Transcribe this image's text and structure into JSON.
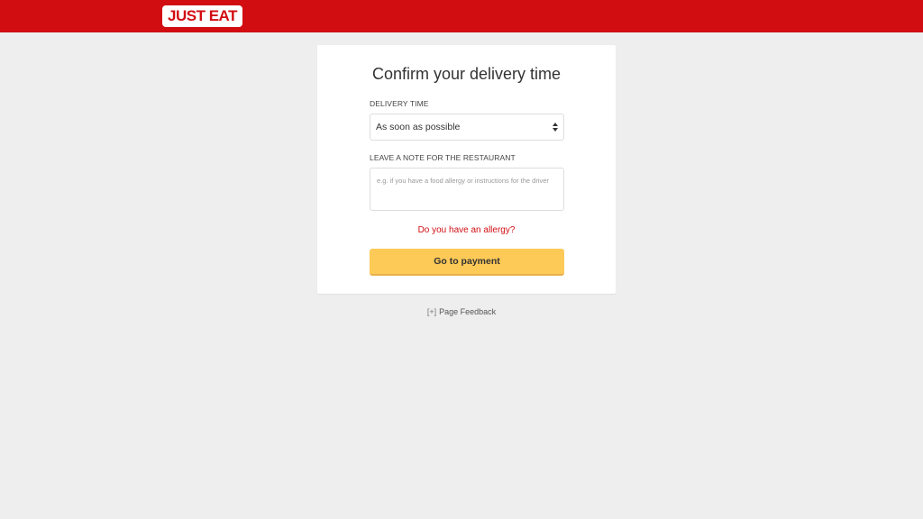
{
  "header": {
    "logo_text": "JUST EAT",
    "brand_color": "#d20d12"
  },
  "card": {
    "title": "Confirm your delivery time",
    "delivery_time": {
      "label": "DELIVERY TIME",
      "selected": "As soon as possible",
      "icon": "select-arrows-icon"
    },
    "note": {
      "label": "LEAVE A NOTE FOR THE RESTAURANT",
      "placeholder": "e.g. if you have a food allergy or instructions for the driver",
      "value": ""
    },
    "allergy_link": "Do you have an allergy?",
    "pay_button": "Go to payment",
    "button_color": "#fdc957"
  },
  "footer": {
    "feedback_icon": "[+]",
    "feedback_label": "Page Feedback"
  }
}
